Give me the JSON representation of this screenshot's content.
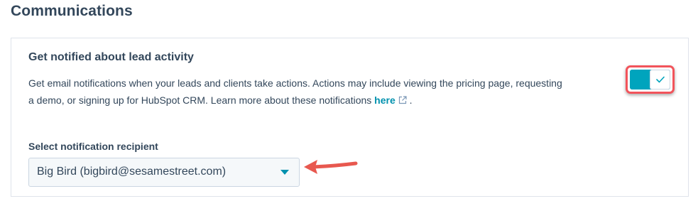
{
  "section": {
    "title": "Communications"
  },
  "card": {
    "heading": "Get notified about lead activity",
    "description_text": "Get email notifications when your leads and clients take actions. Actions may include viewing the pricing page, requesting a demo, or signing up for HubSpot CRM. Learn more about these notifications ",
    "link_label": "here",
    "trailing_period": " .",
    "toggle": {
      "state": "on",
      "on_color": "#00a4bd",
      "highlight_color": "#f2545b",
      "icon": "checkmark-icon"
    },
    "recipient": {
      "label": "Select notification recipient",
      "selected_value": "Big Bird (bigbird@sesamestreet.com)"
    }
  },
  "annotation": {
    "arrow_color": "#f2545b",
    "icon": "arrow-left-icon"
  },
  "colors": {
    "text": "#33475b",
    "link": "#0091ae",
    "border": "#dfe3eb"
  }
}
